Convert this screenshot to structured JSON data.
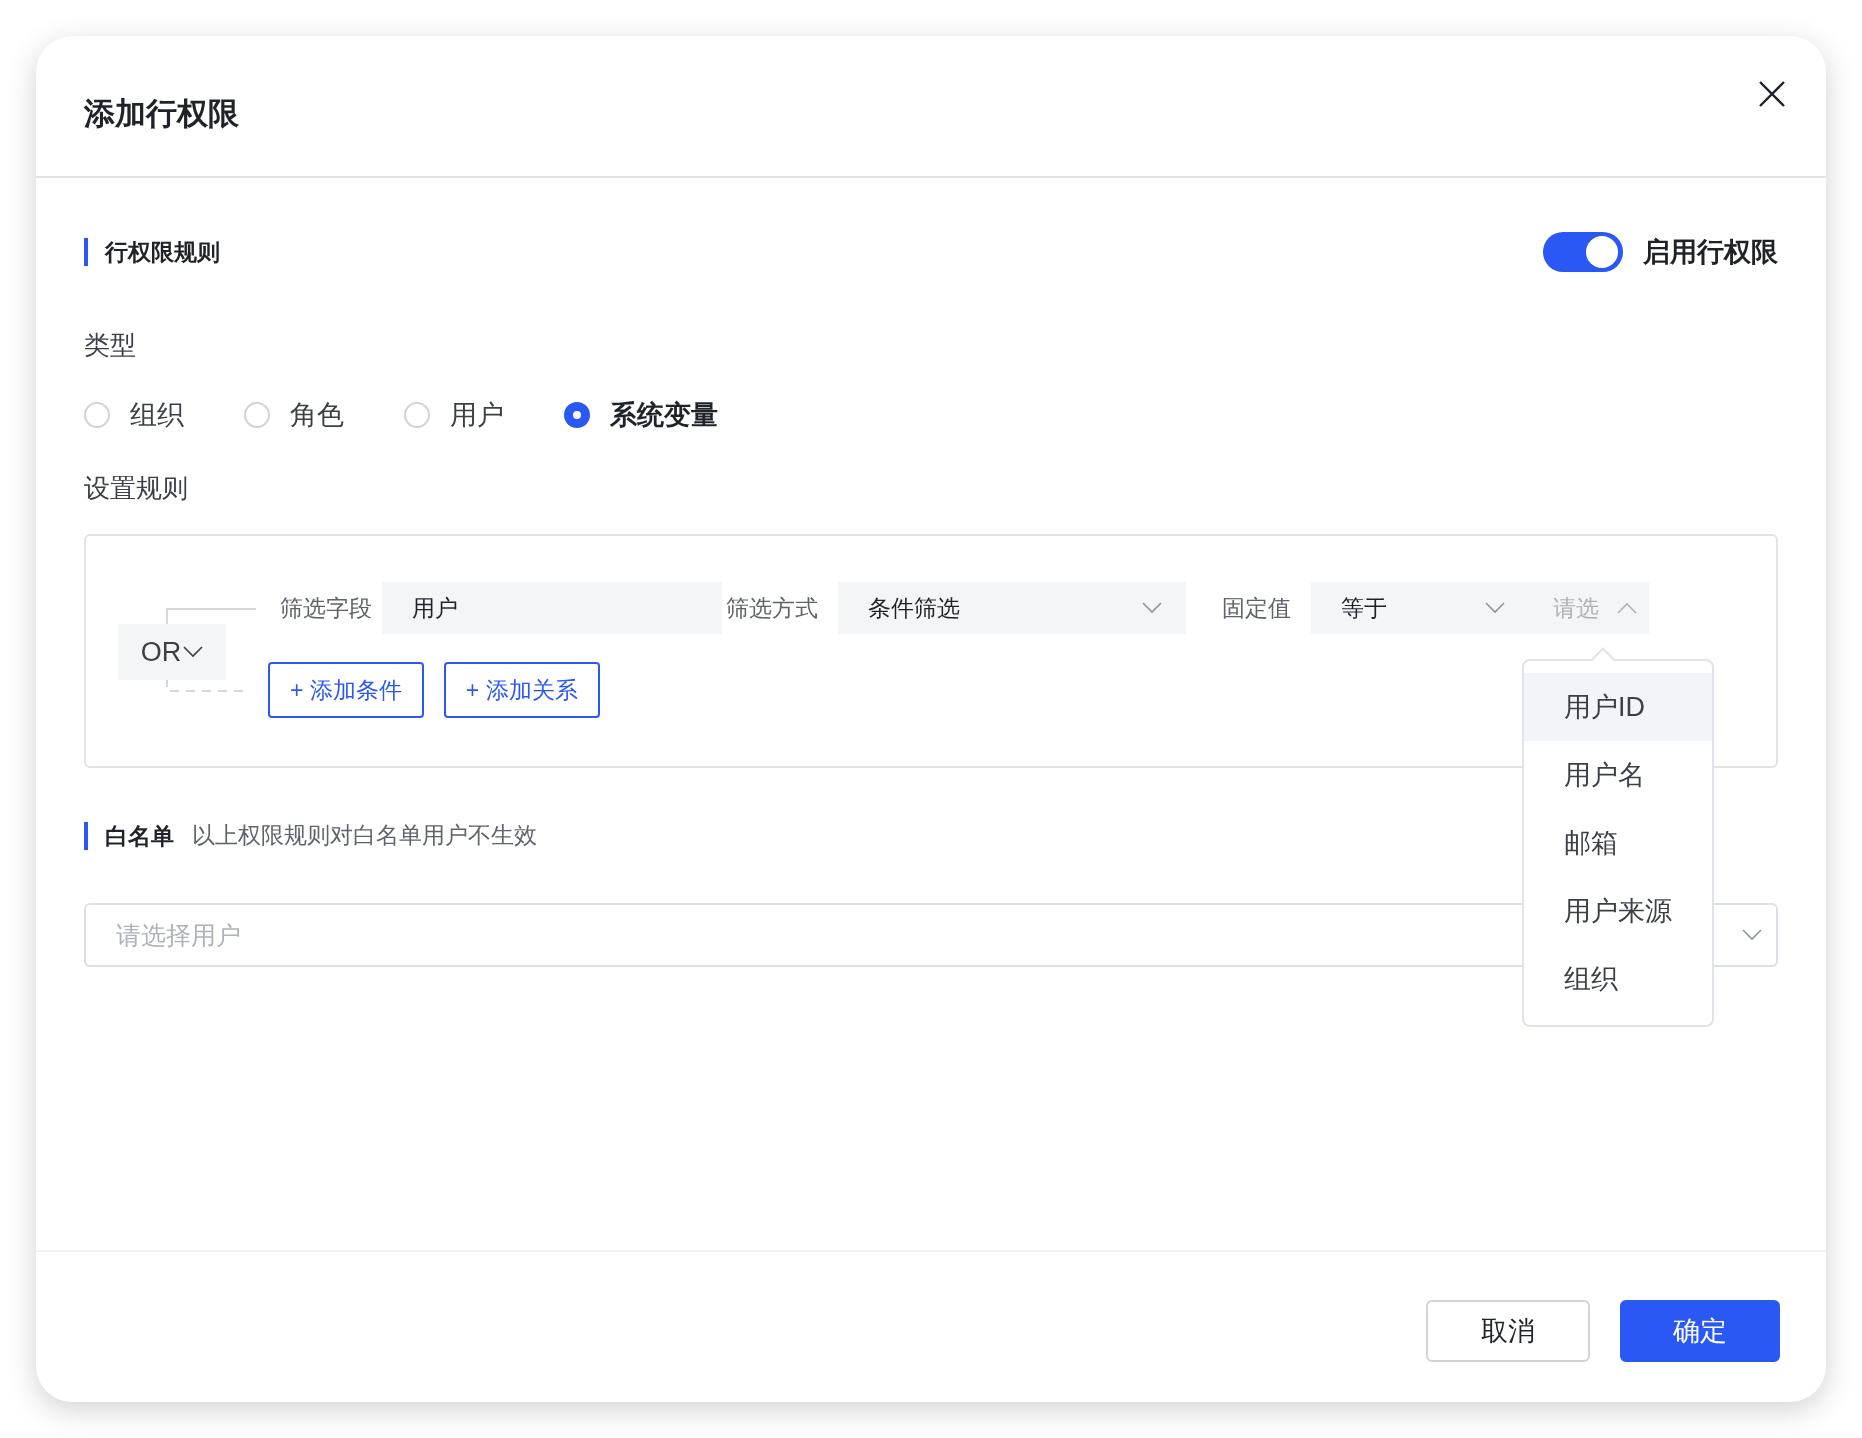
{
  "dialog": {
    "title": "添加行权限"
  },
  "rule_section": {
    "heading": "行权限规则",
    "enable_toggle": {
      "label": "启用行权限",
      "on": true
    }
  },
  "type": {
    "label": "类型",
    "options": [
      {
        "label": "组织",
        "selected": false
      },
      {
        "label": "角色",
        "selected": false
      },
      {
        "label": "用户",
        "selected": false
      },
      {
        "label": "系统变量",
        "selected": true
      }
    ]
  },
  "rules": {
    "label": "设置规则",
    "relation": "OR",
    "condition": {
      "field_label": "筛选字段",
      "field_value": "用户",
      "method_label": "筛选方式",
      "method_value": "条件筛选",
      "value_label": "固定值",
      "operator": "等于",
      "value_placeholder": "请选",
      "value_expanded": true
    },
    "buttons": [
      "+ 添加条件",
      "+ 添加关系"
    ],
    "dropdown": {
      "options": [
        {
          "label": "用户ID",
          "selected": true
        },
        {
          "label": "用户名",
          "selected": false
        },
        {
          "label": "邮箱",
          "selected": false
        },
        {
          "label": "用户来源",
          "selected": false
        },
        {
          "label": "组织",
          "selected": false
        }
      ]
    }
  },
  "whitelist": {
    "heading": "白名单",
    "hint": "以上权限规则对白名单用户不生效",
    "placeholder": "请选择用户"
  },
  "footer": {
    "buttons": [
      {
        "label": "取消",
        "kind": "secondary"
      },
      {
        "label": "确定",
        "kind": "primary"
      }
    ]
  }
}
